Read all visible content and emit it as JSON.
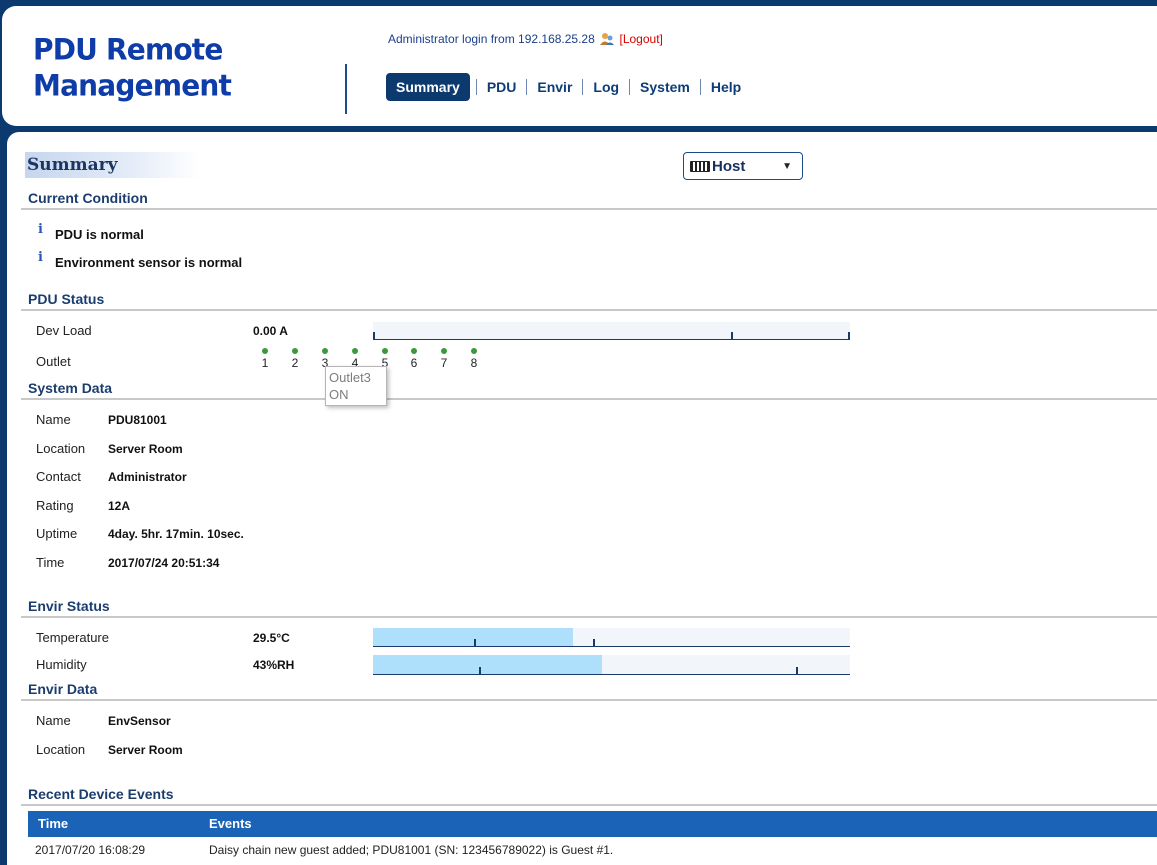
{
  "header": {
    "brand_line1": "PDU Remote",
    "brand_line2": "Management",
    "login_text": "Administrator login from 192.168.25.28",
    "logout_label": "[Logout]",
    "nav": [
      {
        "label": "Summary",
        "active": true
      },
      {
        "label": "PDU"
      },
      {
        "label": "Envir"
      },
      {
        "label": "Log"
      },
      {
        "label": "System"
      },
      {
        "label": "Help"
      }
    ]
  },
  "page": {
    "title": "Summary",
    "host_select": {
      "value": "Host",
      "icon": "keyboard-icon"
    }
  },
  "current_condition": {
    "heading": "Current Condition",
    "items": [
      "PDU is normal",
      "Environment sensor is normal"
    ],
    "icon": "info-icon"
  },
  "pdu_status": {
    "heading": "PDU Status",
    "dev_load_label": "Dev Load",
    "dev_load_value": "0.00 A",
    "dev_load_fraction": 0.0,
    "outlet_label": "Outlet",
    "outlets": [
      {
        "num": "1",
        "state": "on"
      },
      {
        "num": "2",
        "state": "on"
      },
      {
        "num": "3",
        "state": "on"
      },
      {
        "num": "4",
        "state": "on"
      },
      {
        "num": "5",
        "state": "on"
      },
      {
        "num": "6",
        "state": "on"
      },
      {
        "num": "7",
        "state": "on"
      },
      {
        "num": "8",
        "state": "on"
      }
    ],
    "tooltip": {
      "line1": "Outlet3",
      "line2": "ON"
    }
  },
  "system_data": {
    "heading": "System Data",
    "rows": [
      {
        "label": "Name",
        "value": "PDU81001"
      },
      {
        "label": "Location",
        "value": "Server Room"
      },
      {
        "label": "Contact",
        "value": "Administrator"
      },
      {
        "label": "Rating",
        "value": "12A"
      },
      {
        "label": "Uptime",
        "value": "4day. 5hr. 17min. 10sec."
      },
      {
        "label": "Time",
        "value": "2017/07/24 20:51:34"
      }
    ]
  },
  "envir_status": {
    "heading": "Envir Status",
    "temperature_label": "Temperature",
    "temperature_value": "29.5°C",
    "temperature_fraction": 0.42,
    "humidity_label": "Humidity",
    "humidity_value": "43%RH",
    "humidity_fraction": 0.48
  },
  "envir_data": {
    "heading": "Envir Data",
    "rows": [
      {
        "label": "Name",
        "value": "EnvSensor"
      },
      {
        "label": "Location",
        "value": "Server Room"
      }
    ]
  },
  "events": {
    "heading": "Recent Device Events",
    "columns": [
      "Time",
      "Events"
    ],
    "rows": [
      {
        "time": "2017/07/20 16:08:29",
        "event": "Daisy chain new guest added; PDU81001 (SN: 123456789022) is Guest #1."
      }
    ]
  },
  "colors": {
    "frame": "#0d3a6e",
    "brand": "#0e3ca8",
    "table_header": "#1a63b6",
    "bar_fill": "#aee0fb",
    "outlet_on": "#3a9a3a"
  }
}
